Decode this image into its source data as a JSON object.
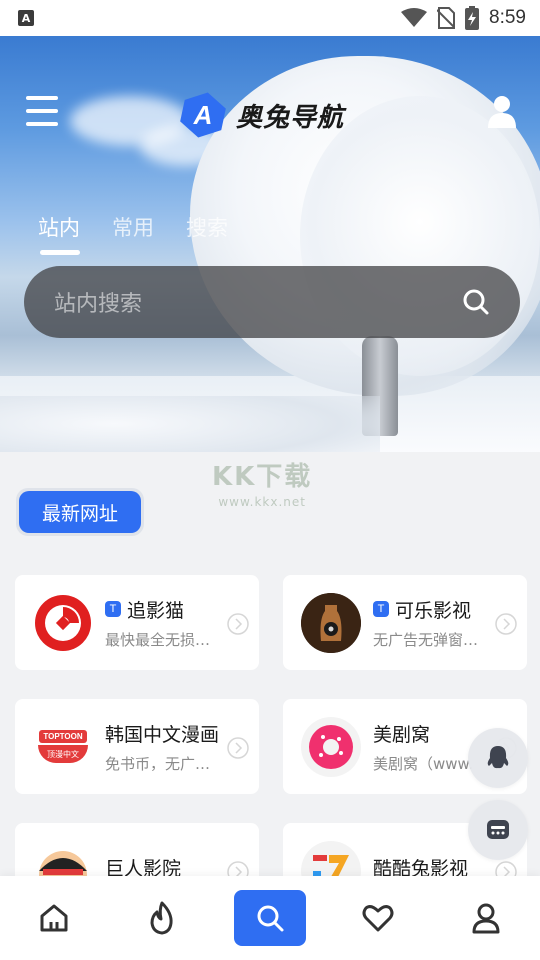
{
  "status_bar": {
    "time": "8:59",
    "app_glyph": "A"
  },
  "header": {
    "brand_title": "奥兔导航",
    "brand_logo_letter": "A",
    "tabs": [
      {
        "label": "站内",
        "active": true
      },
      {
        "label": "常用",
        "active": false
      },
      {
        "label": "搜索",
        "active": false
      }
    ],
    "search_placeholder": "站内搜索"
  },
  "watermark": {
    "title": "KK下载",
    "url": "www.kkx.net"
  },
  "section": {
    "latest_label": "最新网址"
  },
  "cards": [
    {
      "title": "追影猫",
      "desc": "最快最全无损…",
      "badge": "T",
      "logo": "red-swirl"
    },
    {
      "title": "可乐影视",
      "desc": "无广告无弹窗…",
      "badge": "T",
      "logo": "cola-bottle"
    },
    {
      "title": "韩国中文漫画",
      "desc": "免书币，无广…",
      "badge": "",
      "logo": "toptoon",
      "logo_text_top": "TOPTOON",
      "logo_text_bottom": "顶漫中文"
    },
    {
      "title": "美剧窝",
      "desc": "美剧窝（www.",
      "badge": "",
      "logo": "pink-donut"
    },
    {
      "title": "巨人影院",
      "desc": "",
      "badge": "",
      "logo": "giant-face"
    },
    {
      "title": "酷酷兔影视",
      "desc": "",
      "badge": "",
      "logo": "colorful-7"
    }
  ],
  "colors": {
    "accent": "#2f6ef2",
    "card_bg": "#ffffff",
    "page_bg": "#f1f2f4"
  },
  "bottom_nav": [
    {
      "icon": "home-icon",
      "active": false
    },
    {
      "icon": "fire-icon",
      "active": false
    },
    {
      "icon": "search-icon",
      "active": true
    },
    {
      "icon": "heart-icon",
      "active": false
    },
    {
      "icon": "profile-icon",
      "active": false
    }
  ]
}
